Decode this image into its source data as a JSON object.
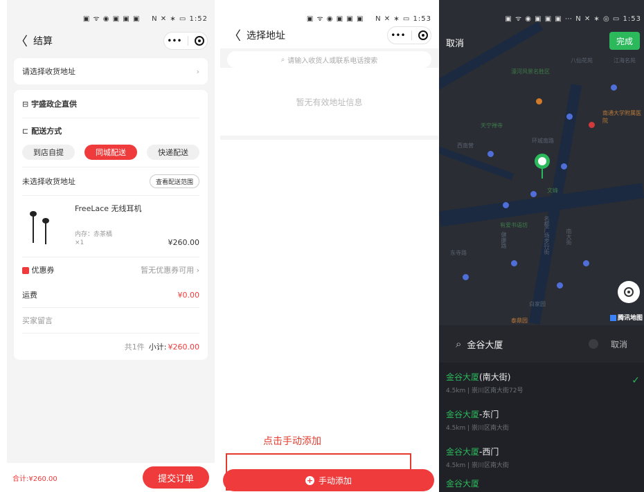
{
  "colors": {
    "accent_red": "#ef3b3b",
    "accent_green": "#2bb95c"
  },
  "checkout": {
    "status_time": "1:52",
    "back_icon": "chevron-left-icon",
    "title": "结算",
    "address_placeholder": "请选择收货地址",
    "store_name": "宇盛政企直供",
    "delivery_label": "配送方式",
    "delivery_options": [
      "到店自提",
      "同城配送",
      "快递配送"
    ],
    "selected_delivery": "同城配送",
    "no_address_text": "未选择收货地址",
    "view_range_btn": "查看配送范围",
    "product": {
      "name": "FreeLace 无线耳机",
      "spec": "内存：赤茶橘",
      "qty": "×1",
      "price": "¥260.00"
    },
    "coupon_label": "优惠券",
    "coupon_value": "暂无优惠券可用",
    "freight_label": "运费",
    "freight_value": "¥0.00",
    "message_label": "买家留言",
    "summary_count": "共1件",
    "summary_label": "小计:",
    "summary_value": "¥260.00",
    "total_label": "合计:",
    "total_value": "¥260.00",
    "submit_btn": "提交订单"
  },
  "address": {
    "status_time": "1:53",
    "title": "选择地址",
    "search_placeholder": "请输入收货人或联系电话搜索",
    "empty_text": "暂无有效地址信息",
    "annotation": "点击手动添加",
    "add_btn": "手动添加"
  },
  "map": {
    "status_time": "1:53",
    "cancel": "取消",
    "done": "完成",
    "search_text": "金谷大厦",
    "search_cancel": "取消",
    "brand": "腾讯地图",
    "labels": [
      "八仙花苑",
      "江海名苑",
      "濠河风景名胜区",
      "环城南路",
      "西南营",
      "文峰",
      "有爱书语坊",
      "名都广场步行街",
      "南大街",
      "东寺路",
      "白家园",
      "泰鼎园",
      "健康路",
      "天宁禅寺",
      "南通大学附属医院"
    ],
    "results": [
      {
        "hl": "金谷大厦",
        "rest": "(南大街)",
        "sub": "4.5km | 崇川区南大街72号",
        "checked": true
      },
      {
        "hl": "金谷大厦",
        "rest": "-东门",
        "sub": "4.5km | 崇川区南大街",
        "checked": false
      },
      {
        "hl": "金谷大厦",
        "rest": "-西门",
        "sub": "4.5km | 崇川区南大街",
        "checked": false
      },
      {
        "hl": "金谷大厦",
        "rest": "",
        "sub": "",
        "checked": false
      }
    ]
  }
}
